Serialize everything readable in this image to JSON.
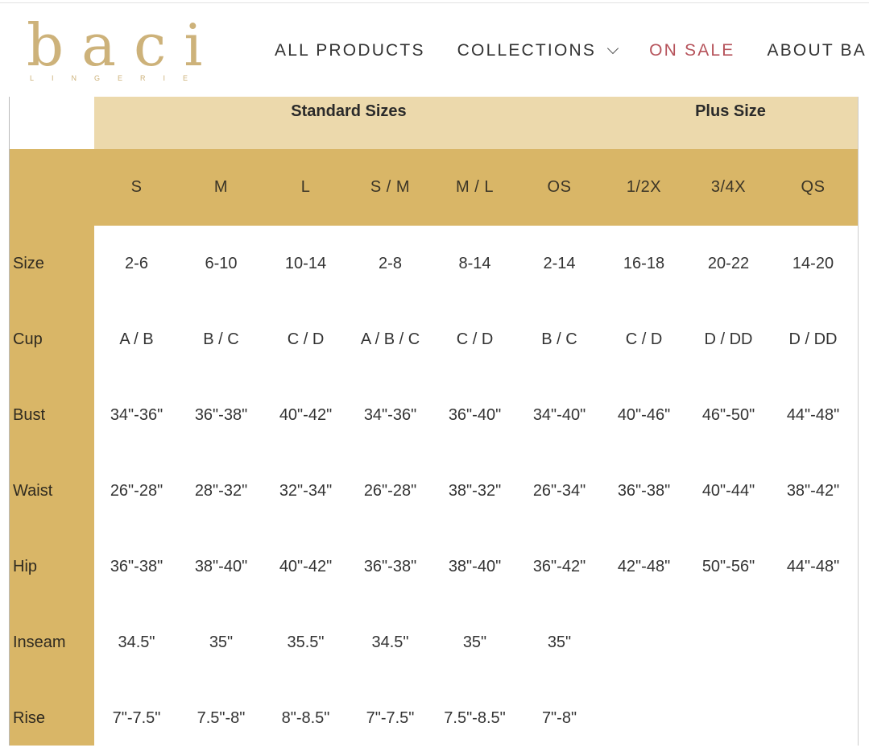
{
  "brand": {
    "name": "baci",
    "tagline": "LINGERIE",
    "color": "#cdb27a"
  },
  "nav": {
    "items": [
      {
        "label": "ALL PRODUCTS"
      },
      {
        "label": "COLLECTIONS",
        "has_dropdown": true
      },
      {
        "label": "ON SALE",
        "color": "#b6535b"
      },
      {
        "label": "ABOUT BA"
      }
    ]
  },
  "size_chart": {
    "colors": {
      "group_band": "#ecd9ac",
      "header_band": "#d9b667"
    },
    "groups": [
      {
        "label": "Standard Sizes"
      },
      {
        "label": "Plus Size"
      }
    ],
    "columns": [
      "S",
      "M",
      "L",
      "S / M",
      "M / L",
      "OS",
      "1/2X",
      "3/4X",
      "QS"
    ],
    "rows": [
      {
        "label": "Size",
        "values": [
          "2-6",
          "6-10",
          "10-14",
          "2-8",
          "8-14",
          "2-14",
          "16-18",
          "20-22",
          "14-20"
        ]
      },
      {
        "label": "Cup",
        "values": [
          "A / B",
          "B / C",
          "C / D",
          "A / B / C",
          "C / D",
          "B / C",
          "C / D",
          "D / DD",
          "D / DD"
        ]
      },
      {
        "label": "Bust",
        "values": [
          "34\"-36\"",
          "36\"-38\"",
          "40\"-42\"",
          "34\"-36\"",
          "36\"-40\"",
          "34\"-40\"",
          "40\"-46\"",
          "46\"-50\"",
          "44\"-48\""
        ]
      },
      {
        "label": "Waist",
        "values": [
          "26\"-28\"",
          "28\"-32\"",
          "32\"-34\"",
          "26\"-28\"",
          "38\"-32\"",
          "26\"-34\"",
          "36\"-38\"",
          "40\"-44\"",
          "38\"-42\""
        ]
      },
      {
        "label": "Hip",
        "values": [
          "36\"-38\"",
          "38\"-40\"",
          "40\"-42\"",
          "36\"-38\"",
          "38\"-40\"",
          "36\"-42\"",
          "42\"-48\"",
          "50\"-56\"",
          "44\"-48\""
        ]
      },
      {
        "label": "Inseam",
        "values": [
          "34.5\"",
          "35\"",
          "35.5\"",
          "34.5\"",
          "35\"",
          "35\"",
          "",
          "",
          ""
        ]
      },
      {
        "label": "Rise",
        "values": [
          "7\"-7.5\"",
          "7.5\"-8\"",
          "8\"-8.5\"",
          "7\"-7.5\"",
          "7.5\"-8.5\"",
          "7\"-8\"",
          "",
          "",
          ""
        ]
      }
    ]
  }
}
